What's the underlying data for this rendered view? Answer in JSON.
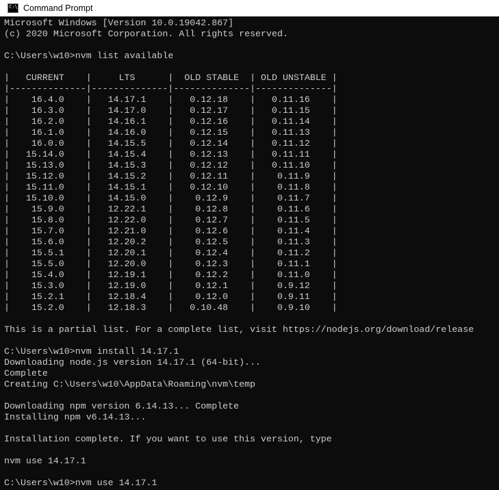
{
  "window": {
    "title": "Command Prompt",
    "icon_name": "command-prompt-icon",
    "icon_glyph": "C:\\_"
  },
  "colors": {
    "background": "#0c0c0c",
    "foreground": "#cccccc",
    "titlebar": "#ffffff"
  },
  "console": {
    "lines": [
      "Microsoft Windows [Version 10.0.19042.867]",
      "(c) 2020 Microsoft Corporation. All rights reserved.",
      "",
      "C:\\Users\\w10>nvm list available",
      "",
      "|   CURRENT    |     LTS      |  OLD STABLE  | OLD UNSTABLE |",
      "|--------------|--------------|--------------|--------------|",
      "|    16.4.0    |   14.17.1    |   0.12.18    |   0.11.16    |",
      "|    16.3.0    |   14.17.0    |   0.12.17    |   0.11.15    |",
      "|    16.2.0    |   14.16.1    |   0.12.16    |   0.11.14    |",
      "|    16.1.0    |   14.16.0    |   0.12.15    |   0.11.13    |",
      "|    16.0.0    |   14.15.5    |   0.12.14    |   0.11.12    |",
      "|   15.14.0    |   14.15.4    |   0.12.13    |   0.11.11    |",
      "|   15.13.0    |   14.15.3    |   0.12.12    |   0.11.10    |",
      "|   15.12.0    |   14.15.2    |   0.12.11    |    0.11.9    |",
      "|   15.11.0    |   14.15.1    |   0.12.10    |    0.11.8    |",
      "|   15.10.0    |   14.15.0    |    0.12.9    |    0.11.7    |",
      "|    15.9.0    |   12.22.1    |    0.12.8    |    0.11.6    |",
      "|    15.8.0    |   12.22.0    |    0.12.7    |    0.11.5    |",
      "|    15.7.0    |   12.21.0    |    0.12.6    |    0.11.4    |",
      "|    15.6.0    |   12.20.2    |    0.12.5    |    0.11.3    |",
      "|    15.5.1    |   12.20.1    |    0.12.4    |    0.11.2    |",
      "|    15.5.0    |   12.20.0    |    0.12.3    |    0.11.1    |",
      "|    15.4.0    |   12.19.1    |    0.12.2    |    0.11.0    |",
      "|    15.3.0    |   12.19.0    |    0.12.1    |    0.9.12    |",
      "|    15.2.1    |   12.18.4    |    0.12.0    |    0.9.11    |",
      "|    15.2.0    |   12.18.3    |   0.10.48    |    0.9.10    |",
      "",
      "This is a partial list. For a complete list, visit https://nodejs.org/download/release",
      "",
      "C:\\Users\\w10>nvm install 14.17.1",
      "Downloading node.js version 14.17.1 (64-bit)...",
      "Complete",
      "Creating C:\\Users\\w10\\AppData\\Roaming\\nvm\\temp",
      "",
      "Downloading npm version 6.14.13... Complete",
      "Installing npm v6.14.13...",
      "",
      "Installation complete. If you want to use this version, type",
      "",
      "nvm use 14.17.1",
      "",
      "C:\\Users\\w10>nvm use 14.17.1"
    ]
  }
}
